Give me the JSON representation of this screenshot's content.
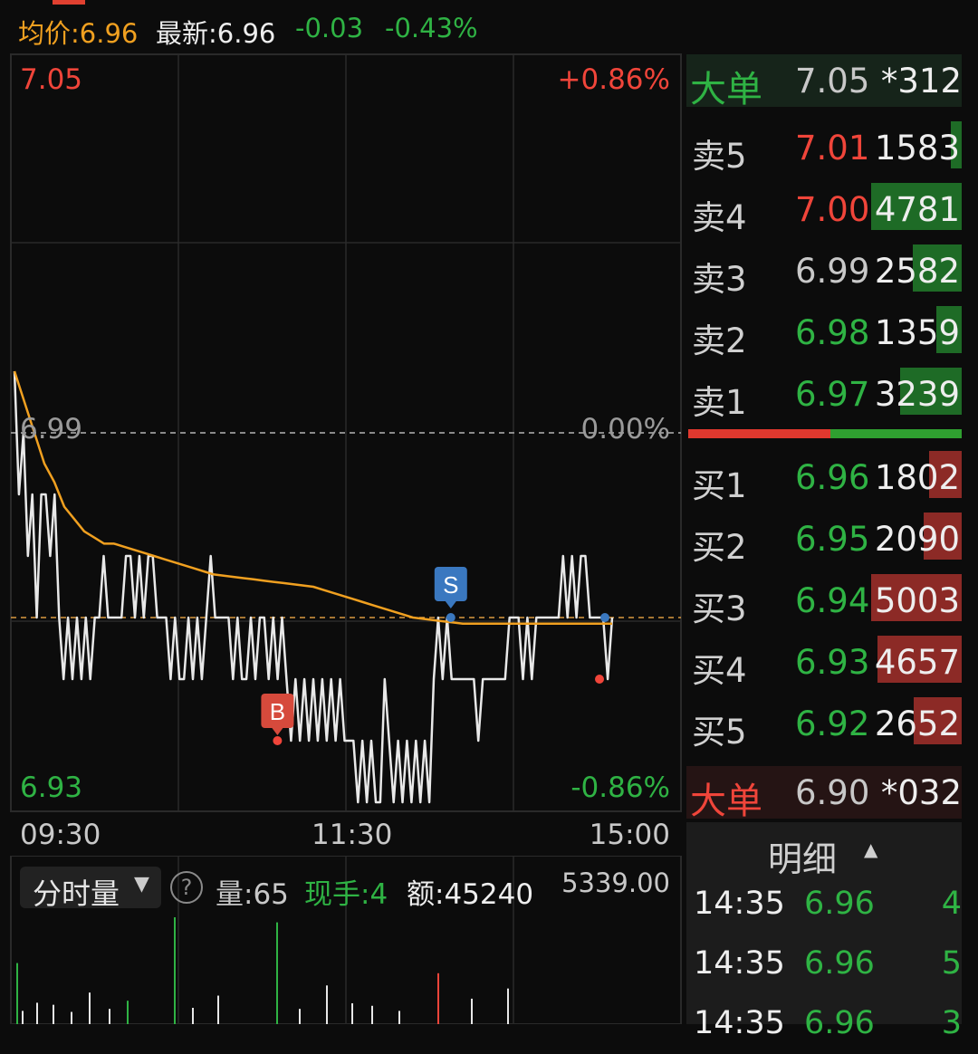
{
  "topbar": {
    "avg_label": "均价:6.96",
    "latest_label": "最新:6.96",
    "change": "-0.03",
    "change_pct": "-0.43%"
  },
  "colors": {
    "up": "#f0453a",
    "down": "#2fb344",
    "avg_line": "#f0a020",
    "price_line": "#e8e8e8",
    "grid": "#2a2a2a",
    "sell_bar": "#1e6b26",
    "buy_bar": "#8c2a26"
  },
  "chart_data": [
    {
      "type": "line",
      "price_axis": {
        "top": "7.05",
        "bottom": "6.93",
        "mid": "6.99"
      },
      "pct_axis": {
        "top": "+0.86%",
        "mid": "0.00%",
        "bottom": "-0.86%"
      },
      "time_labels": [
        "09:30",
        "11:30",
        "15:00"
      ],
      "ylim": [
        6.93,
        7.05
      ],
      "reference_price": 6.99,
      "series": [
        {
          "values": [
            7.0,
            6.98,
            6.99,
            6.97,
            6.98,
            6.96,
            6.98,
            6.98,
            6.97,
            6.98,
            6.96,
            6.95,
            6.96,
            6.95,
            6.96,
            6.95,
            6.96,
            6.95,
            6.96,
            6.96,
            6.97,
            6.96,
            6.96,
            6.96,
            6.96,
            6.97,
            6.97,
            6.96,
            6.97,
            6.96,
            6.97,
            6.97,
            6.96,
            6.96,
            6.96,
            6.95,
            6.96,
            6.95,
            6.95,
            6.96,
            6.95,
            6.96,
            6.95,
            6.96,
            6.97,
            6.96,
            6.96,
            6.96,
            6.96,
            6.95,
            6.96,
            6.95,
            6.95,
            6.96,
            6.95,
            6.96,
            6.96,
            6.95,
            6.96,
            6.95,
            6.96,
            6.95,
            6.94,
            6.95,
            6.94,
            6.95,
            6.94,
            6.95,
            6.94,
            6.95,
            6.94,
            6.95,
            6.94,
            6.95,
            6.94,
            6.94,
            6.94,
            6.93,
            6.94,
            6.93,
            6.94,
            6.93,
            6.93,
            6.95,
            6.94,
            6.93,
            6.94,
            6.93,
            6.94,
            6.93,
            6.94,
            6.93,
            6.94,
            6.93,
            6.95,
            6.96,
            6.95,
            6.96,
            6.95,
            6.95,
            6.95,
            6.95,
            6.95,
            6.95,
            6.94,
            6.95,
            6.95,
            6.95,
            6.95,
            6.95,
            6.95,
            6.96,
            6.96,
            6.96,
            6.95,
            6.96,
            6.95,
            6.96,
            6.96,
            6.96,
            6.96,
            6.96,
            6.96,
            6.97,
            6.96,
            6.97,
            6.96,
            6.97,
            6.97,
            6.96,
            6.96,
            6.96,
            6.96,
            6.95,
            6.96
          ]
        },
        {
          "values": [
            7.0,
            6.995,
            6.99,
            6.985,
            6.982,
            6.978,
            6.976,
            6.974,
            6.973,
            6.972,
            6.972,
            6.9715,
            6.971,
            6.9705,
            6.97,
            6.9695,
            6.969,
            6.9685,
            6.968,
            6.9675,
            6.967,
            6.9668,
            6.9666,
            6.9664,
            6.9662,
            6.966,
            6.9658,
            6.9656,
            6.9654,
            6.9652,
            6.965,
            6.9645,
            6.964,
            6.9635,
            6.963,
            6.9625,
            6.962,
            6.9615,
            6.961,
            6.9605,
            6.96,
            6.9598,
            6.9596,
            6.9594,
            6.9592,
            6.959,
            6.959,
            6.959,
            6.959,
            6.959,
            6.959,
            6.959,
            6.959,
            6.959,
            6.959,
            6.959,
            6.959,
            6.959,
            6.959,
            6.959,
            6.959
          ]
        }
      ],
      "markers": [
        {
          "label": "B",
          "type": "buy",
          "price": 6.94,
          "position": 0.44
        },
        {
          "label": "S",
          "type": "sell",
          "price": 6.96,
          "position": 0.73
        }
      ]
    },
    {
      "type": "bar",
      "title": "分时量",
      "max_label": "5339.00",
      "values": [
        1200,
        260,
        420,
        380,
        240,
        620,
        300,
        460,
        2100,
        320,
        560,
        2000,
        300,
        760,
        410,
        360,
        260,
        1000,
        500,
        700
      ]
    }
  ],
  "volume_bar": {
    "label": "分时量",
    "qty": "量:65",
    "hand": "现手:4",
    "amount": "额:45240",
    "max": "5339.00",
    "help_icon": "question-circle-icon"
  },
  "orderbook": {
    "big_sell": {
      "label": "大单",
      "price": "7.05",
      "vol": "*312"
    },
    "big_buy": {
      "label": "大单",
      "price": "6.90",
      "vol": "*032"
    },
    "asks": [
      {
        "label": "卖5",
        "price": "7.01",
        "vol": "1583",
        "ratio": 0.12
      },
      {
        "label": "卖4",
        "price": "7.00",
        "vol": "4781",
        "ratio": 1.0
      },
      {
        "label": "卖3",
        "price": "6.99",
        "vol": "2582",
        "ratio": 0.54
      },
      {
        "label": "卖2",
        "price": "6.98",
        "vol": "1359",
        "ratio": 0.28
      },
      {
        "label": "卖1",
        "price": "6.97",
        "vol": "3239",
        "ratio": 0.68
      }
    ],
    "bids": [
      {
        "label": "买1",
        "price": "6.96",
        "vol": "1802",
        "ratio": 0.36
      },
      {
        "label": "买2",
        "price": "6.95",
        "vol": "2090",
        "ratio": 0.42
      },
      {
        "label": "买3",
        "price": "6.94",
        "vol": "5003",
        "ratio": 1.0
      },
      {
        "label": "买4",
        "price": "6.93",
        "vol": "4657",
        "ratio": 0.93
      },
      {
        "label": "买5",
        "price": "6.92",
        "vol": "2652",
        "ratio": 0.53
      }
    ],
    "sell_buy_ratio": 0.52
  },
  "detail": {
    "title": "明细",
    "rows": [
      {
        "time": "14:35",
        "price": "6.96",
        "vol": "4"
      },
      {
        "time": "14:35",
        "price": "6.96",
        "vol": "5"
      },
      {
        "time": "14:35",
        "price": "6.96",
        "vol": "3"
      }
    ]
  }
}
